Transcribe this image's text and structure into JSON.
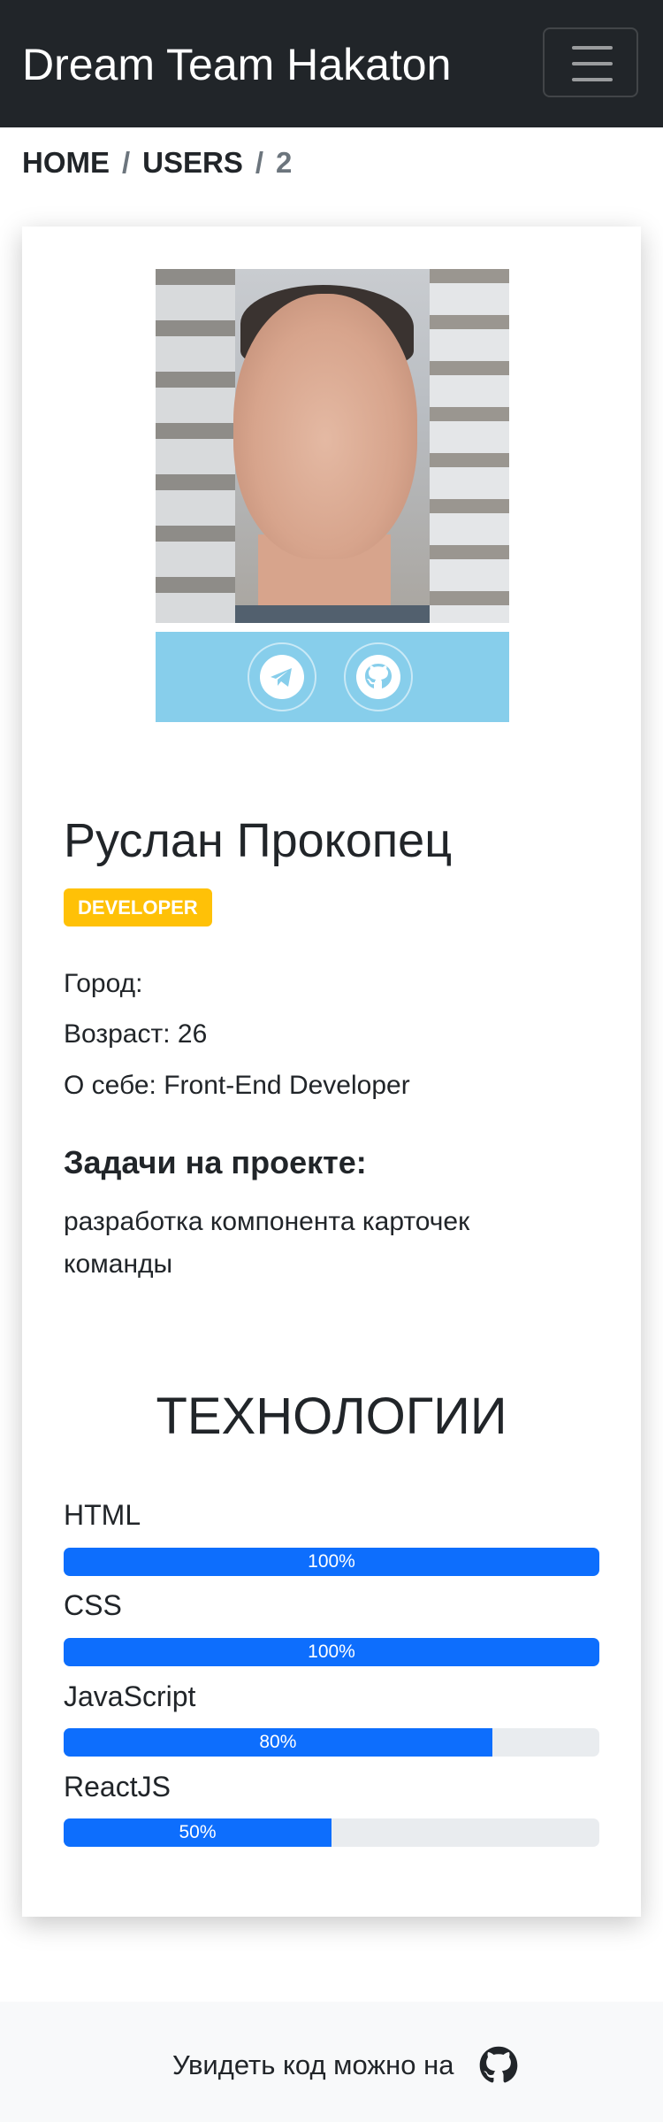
{
  "navbar": {
    "brand": "Dream Team Hakaton",
    "toggle_icon": "hamburger-menu-icon"
  },
  "breadcrumb": {
    "items": [
      "HOME",
      "USERS"
    ],
    "separator": "/",
    "current": "2"
  },
  "profile": {
    "photo_alt": "profile-photo",
    "social": {
      "background": "#87ceeb",
      "icons": [
        "telegram-icon",
        "github-icon"
      ]
    },
    "name": "Руслан Прокопец",
    "role_badge": "DEVELOPER",
    "role_color": "#ffc107",
    "city": "Город:",
    "age": "Возраст: 26",
    "about": "О себе: Front-End Developer",
    "tasks_title": "Задачи на проекте:",
    "tasks_text": "разработка компонента карточек команды"
  },
  "technologies": {
    "title": "ТЕХНОЛОГИИ",
    "bar_color": "#0d6efd",
    "skills": [
      {
        "name": "HTML",
        "percent": 100,
        "label": "100%"
      },
      {
        "name": "CSS",
        "percent": 100,
        "label": "100%"
      },
      {
        "name": "JavaScript",
        "percent": 80,
        "label": "80%"
      },
      {
        "name": "ReactJS",
        "percent": 50,
        "label": "50%"
      }
    ]
  },
  "footer": {
    "text": "Увидеть код можно на",
    "icon": "github-icon"
  }
}
